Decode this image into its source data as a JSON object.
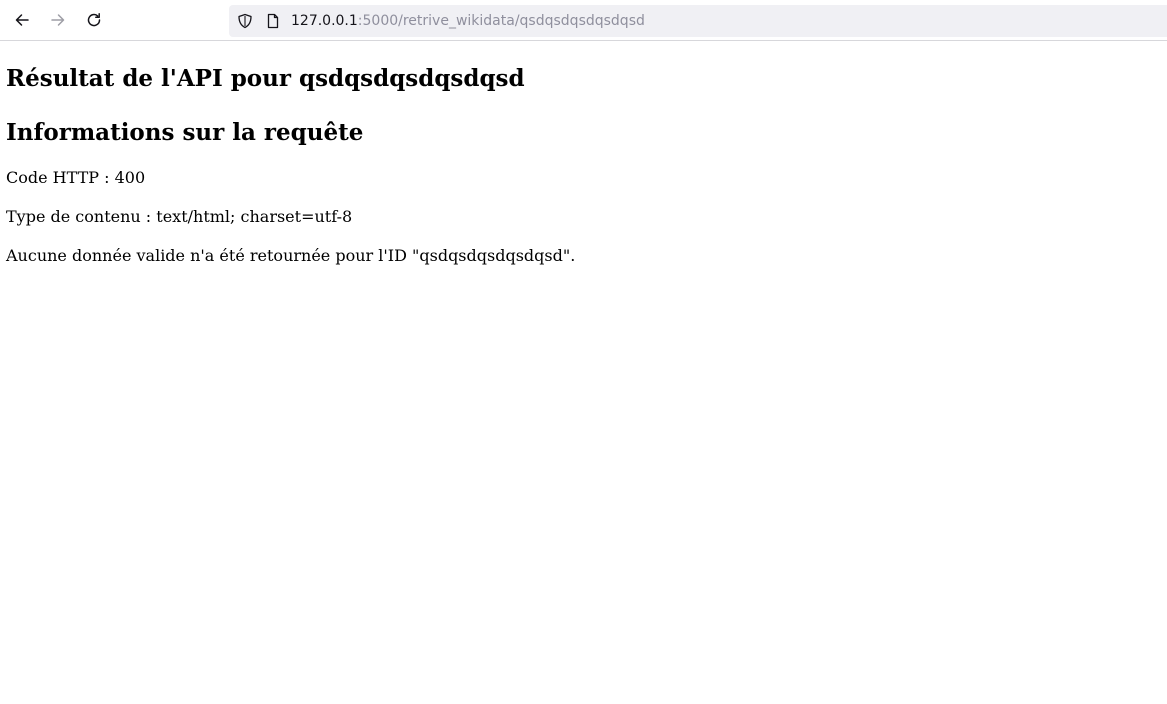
{
  "browser": {
    "url_host": "127.0.0.1",
    "url_rest": ":5000/retrive_wikidata/qsdqsdqsdqsdqsd"
  },
  "page": {
    "title": "Résultat de l'API pour qsdqsdqsdqsdqsd",
    "section_heading": "Informations sur la requête",
    "http_code": "Code HTTP : 400",
    "content_type": "Type de contenu : text/html; charset=utf-8",
    "message": "Aucune donnée valide n'a été retournée pour l'ID \"qsdqsdqsdqsdqsd\"."
  },
  "icons": [
    "back-arrow-icon",
    "forward-arrow-icon",
    "reload-icon",
    "shield-icon",
    "page-icon"
  ],
  "colors": {
    "url_host": "#15141a",
    "url_rest": "#8f8f9d",
    "urlbar_bg": "#f0f0f4",
    "disabled_icon": "#9e9ea6"
  }
}
